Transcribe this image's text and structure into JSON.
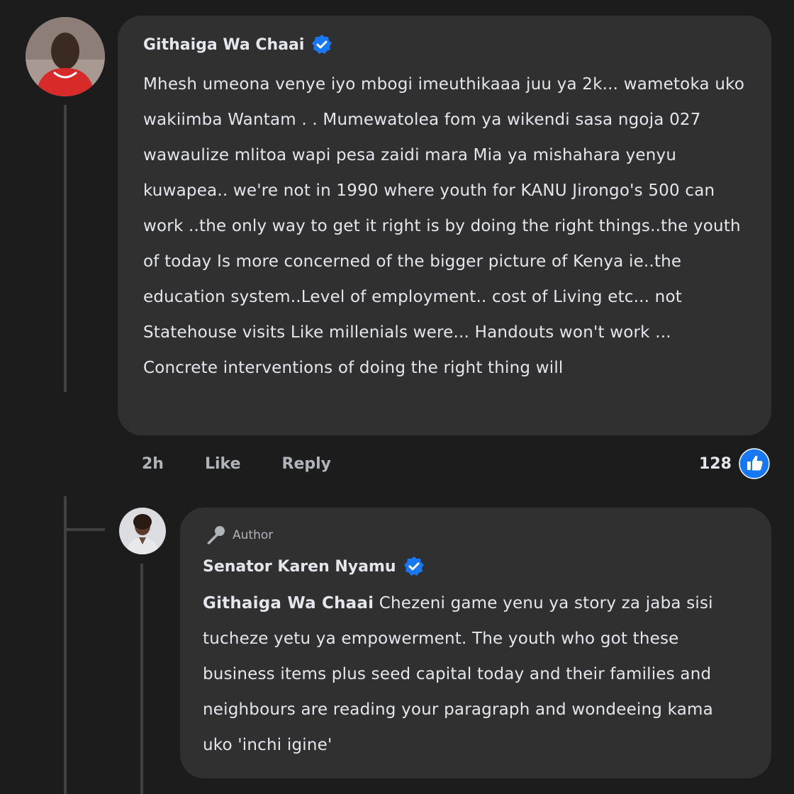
{
  "comment": {
    "author": "Githaiga Wa Chaai",
    "text": "Mhesh umeona venye iyo mbogi imeuthikaaa juu ya 2k... wametoka uko wakiimba Wantam . . Mumewatolea fom ya wikendi sasa ngoja 027 wawaulize mlitoa wapi pesa zaidi mara Mia ya mishahara yenyu kuwapea.. we're not in 1990 where youth for KANU Jirongo's 500 can work ..the only way to get it right is by doing the right things..the youth of today Is more concerned of the bigger picture of Kenya ie..the education system..Level of employment.. cost of Living  etc... not Statehouse visits Like millenials were... Handouts won't work ... Concrete interventions of doing the right thing will",
    "time": "2h",
    "like_label": "Like",
    "reply_label": "Reply",
    "reaction_count": "128"
  },
  "reply": {
    "tag": "Author",
    "author": "Senator Karen Nyamu",
    "mention": "Githaiga Wa Chaai",
    "text": " Chezeni game yenu ya story za jaba sisi tucheze yetu ya empowerment. The youth who got these business items plus seed capital today and their families and neighbours are reading your paragraph and wondeeing kama uko 'inchi igine'"
  },
  "colors": {
    "background": "#1c1c1d",
    "bubble": "#303031",
    "verified": "#1877f2",
    "like": "#1877f2"
  }
}
